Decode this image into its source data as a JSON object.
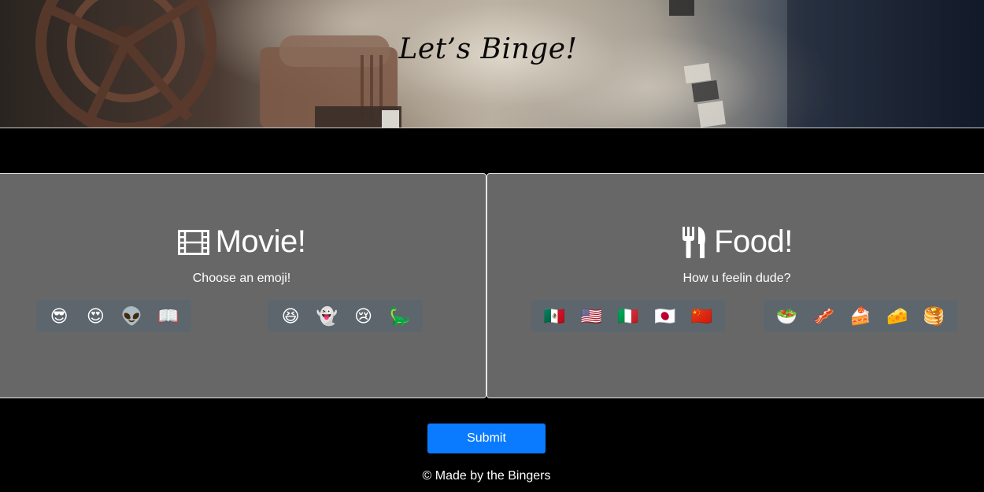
{
  "header": {
    "title": "Let’s Binge!"
  },
  "movie": {
    "heading": "Movie!",
    "icon": "film-icon",
    "subtitle": "Choose an emoji!",
    "group1": [
      {
        "name": "cool-sunglasses-emoji",
        "glyph": "😎"
      },
      {
        "name": "heart-eyes-emoji",
        "glyph": "😍"
      },
      {
        "name": "alien-emoji",
        "glyph": "👽"
      },
      {
        "name": "open-book-emoji",
        "glyph": "📖"
      }
    ],
    "group2": [
      {
        "name": "laughing-emoji",
        "glyph": "😆"
      },
      {
        "name": "ghost-emoji",
        "glyph": "👻"
      },
      {
        "name": "crying-emoji",
        "glyph": "😢"
      },
      {
        "name": "dinosaur-emoji",
        "glyph": "🦕"
      }
    ]
  },
  "food": {
    "heading": "Food!",
    "icon": "fork-knife-icon",
    "subtitle": "How u feelin dude?",
    "group1": [
      {
        "name": "mexico-flag-emoji",
        "glyph": "🇲🇽"
      },
      {
        "name": "usa-flag-emoji",
        "glyph": "🇺🇸"
      },
      {
        "name": "italy-flag-emoji",
        "glyph": "🇮🇹"
      },
      {
        "name": "japan-flag-emoji",
        "glyph": "🇯🇵"
      },
      {
        "name": "china-flag-emoji",
        "glyph": "🇨🇳"
      }
    ],
    "group2": [
      {
        "name": "salad-emoji",
        "glyph": "🥗"
      },
      {
        "name": "bacon-emoji",
        "glyph": "🥓"
      },
      {
        "name": "cake-emoji",
        "glyph": "🍰"
      },
      {
        "name": "cheese-emoji",
        "glyph": "🧀"
      },
      {
        "name": "pancakes-emoji",
        "glyph": "🥞"
      }
    ]
  },
  "footer": {
    "submit_label": "Submit",
    "credit": "© Made by the Bingers"
  },
  "colors": {
    "panel_bg": "#676767",
    "emoji_group_bg": "#5d666d",
    "submit_bg": "#0a7bff",
    "page_bg": "#000000"
  }
}
